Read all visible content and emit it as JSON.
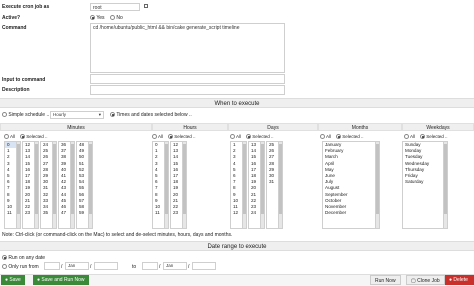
{
  "form": {
    "user_label": "Execute cron job as",
    "user_value": "root",
    "active_label": "Active?",
    "active_yes": "Yes",
    "active_no": "No",
    "command_label": "Command",
    "command_value": "cd /home/ubuntu/public_html && bin/cake generate_script timeline",
    "input_label": "Input to command",
    "description_label": "Description"
  },
  "when": {
    "title": "When to execute",
    "simple_label": "Simple schedule ..",
    "simple_value": "Hourly",
    "times_label": "Times and dates selected below .."
  },
  "columns": [
    {
      "key": "minutes",
      "title": "Minutes"
    },
    {
      "key": "hours",
      "title": "Hours"
    },
    {
      "key": "days",
      "title": "Days"
    },
    {
      "key": "months",
      "title": "Months"
    },
    {
      "key": "weekdays",
      "title": "Weekdays"
    }
  ],
  "all_label": "All",
  "selected_label": "Selected ..",
  "minutes_lists": [
    [
      "0",
      "1",
      "2",
      "3",
      "4",
      "5",
      "6",
      "7",
      "8",
      "9",
      "10",
      "11"
    ],
    [
      "12",
      "13",
      "14",
      "15",
      "16",
      "17",
      "18",
      "19",
      "20",
      "21",
      "22",
      "23"
    ],
    [
      "24",
      "25",
      "26",
      "27",
      "28",
      "29",
      "30",
      "31",
      "32",
      "33",
      "34",
      "35"
    ],
    [
      "36",
      "37",
      "38",
      "39",
      "40",
      "41",
      "42",
      "43",
      "44",
      "45",
      "46",
      "47"
    ],
    [
      "48",
      "49",
      "50",
      "51",
      "52",
      "53",
      "54",
      "55",
      "56",
      "57",
      "58",
      "59"
    ]
  ],
  "hours_lists": [
    [
      "0",
      "1",
      "2",
      "3",
      "4",
      "5",
      "6",
      "7",
      "8",
      "9",
      "10",
      "11"
    ],
    [
      "12",
      "13",
      "14",
      "15",
      "16",
      "17",
      "18",
      "19",
      "20",
      "21",
      "22",
      "23"
    ]
  ],
  "days_lists": [
    [
      "1",
      "2",
      "3",
      "4",
      "5",
      "6",
      "7",
      "8",
      "9",
      "10",
      "11",
      "12"
    ],
    [
      "13",
      "14",
      "15",
      "16",
      "17",
      "18",
      "19",
      "20",
      "21",
      "22",
      "23",
      "24"
    ],
    [
      "25",
      "26",
      "27",
      "28",
      "29",
      "30",
      "31"
    ]
  ],
  "months_list": [
    "January",
    "February",
    "March",
    "April",
    "May",
    "June",
    "July",
    "August",
    "September",
    "October",
    "November",
    "December"
  ],
  "weekdays_list": [
    "Sunday",
    "Monday",
    "Tuesday",
    "Wednesday",
    "Thursday",
    "Friday",
    "Saturday"
  ],
  "note": "Note: Ctrl-click (or command-click on the Mac) to select and de-select minutes, hours, days and months.",
  "range": {
    "title": "Date range to execute",
    "any_label": "Run on any date",
    "only_label": "Only run from",
    "from_month": "Jan",
    "to_label": "to",
    "to_month": "Jan"
  },
  "buttons": {
    "save": "Save",
    "save_run": "Save and Run Now",
    "run_now": "Run Now",
    "clone": "Clone Job",
    "delete": "Delete"
  }
}
